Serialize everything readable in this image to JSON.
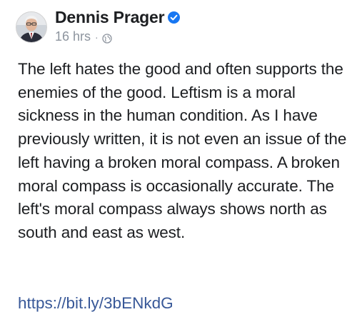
{
  "post": {
    "author": {
      "name": "Dennis Prager",
      "verified_icon": "verified-badge-icon",
      "avatar_icon": "profile-photo"
    },
    "timestamp": "16 hrs",
    "separator": "·",
    "privacy_icon": "globe-icon",
    "body": "The left hates the good and often supports the enemies of the good. Leftism is a moral sickness in the human condition. As I have previously written, it is not even an issue of the left having a broken moral compass. A broken moral compass is occasionally accurate. The left's moral compass always shows north as south and east as west.",
    "link": "https://bit.ly/3bENkdG"
  },
  "colors": {
    "text": "#1c1e21",
    "meta": "#8d949e",
    "link": "#385898",
    "verified": "#1877f2"
  }
}
